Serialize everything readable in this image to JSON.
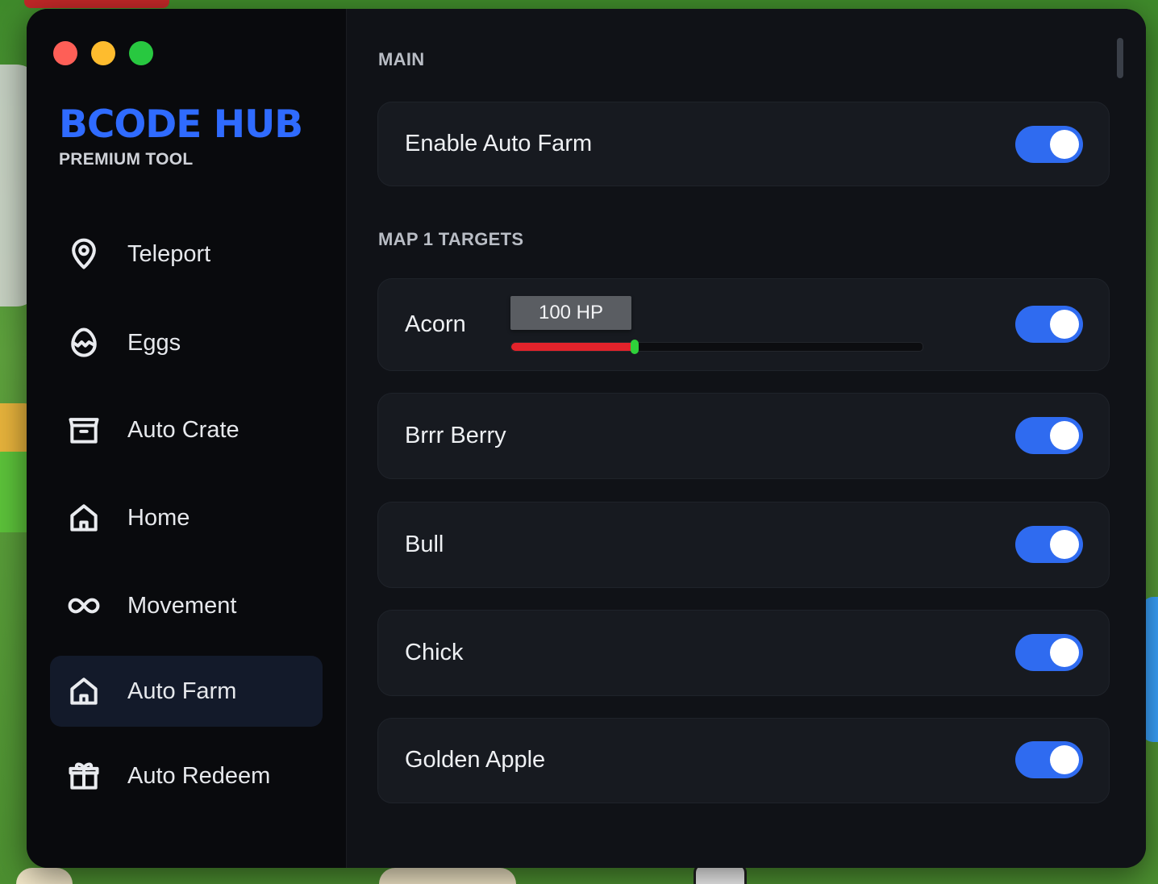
{
  "app": {
    "title": "BCODE HUB",
    "subtitle": "PREMIUM TOOL",
    "accent": "#2f6bff"
  },
  "sidebar": {
    "items": [
      {
        "label": "Teleport",
        "icon": "map-pin-icon",
        "active": false
      },
      {
        "label": "Eggs",
        "icon": "egg-icon",
        "active": false
      },
      {
        "label": "Auto Crate",
        "icon": "crate-icon",
        "active": false
      },
      {
        "label": "Home",
        "icon": "home-icon",
        "active": false
      },
      {
        "label": "Movement",
        "icon": "infinity-icon",
        "active": false
      },
      {
        "label": "Auto Farm",
        "icon": "home-icon",
        "active": true
      },
      {
        "label": "Auto Redeem",
        "icon": "gift-icon",
        "active": false
      }
    ]
  },
  "main": {
    "section_main": "MAIN",
    "enable_auto_farm": {
      "label": "Enable Auto Farm",
      "enabled": true
    },
    "section_targets": "MAP 1 TARGETS",
    "targets": [
      {
        "label": "Acorn",
        "enabled": true,
        "hp_label": "100 HP",
        "hp_fraction": 0.3
      },
      {
        "label": "Brrr Berry",
        "enabled": true
      },
      {
        "label": "Bull",
        "enabled": true
      },
      {
        "label": "Chick",
        "enabled": true
      },
      {
        "label": "Golden Apple",
        "enabled": true
      }
    ]
  },
  "colors": {
    "toggle_on": "#2f6bf0",
    "hp_bar": "#e3232b",
    "hp_thumb": "#2fd13a"
  }
}
